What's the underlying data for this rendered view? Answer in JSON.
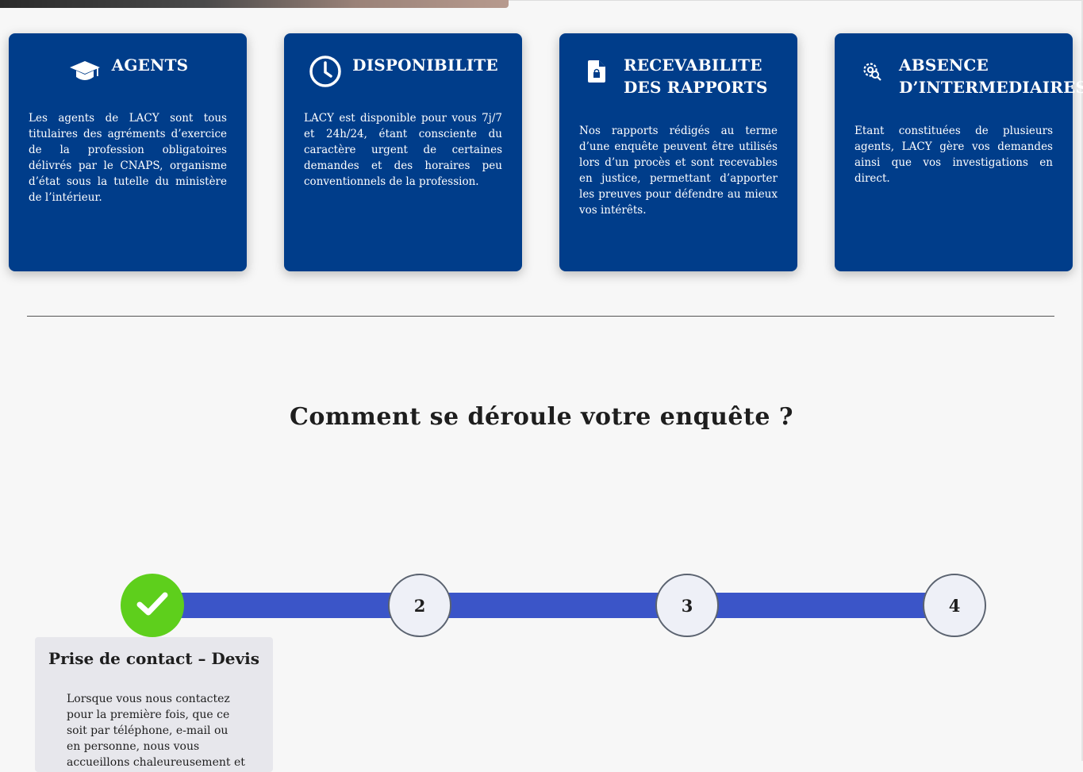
{
  "cards": [
    {
      "icon": "graduation-cap-icon",
      "title": "AGENTS",
      "text": "Les agents de LACY sont tous titulaires des agréments d’exercice de la profession obligatoires délivrés par le CNAPS, organisme d’état sous la tutelle du ministère de l’intérieur."
    },
    {
      "icon": "clock-icon",
      "title": "DISPONIBILITE",
      "text": "LACY est disponible pour vous 7j/7 et 24h/24, étant consciente du caractère urgent de certaines demandes et des horaires peu conventionnels de la profession."
    },
    {
      "icon": "file-lock-icon",
      "title": "RECEVABILITE DES RAPPORTS",
      "text": "Nos rapports rédigés au terme d’une enquête peuvent être utilisés lors d’un procès et sont recevables en justice, permettant d’apporter les preuves pour défendre au mieux vos intérêts."
    },
    {
      "icon": "gear-search-icon",
      "title": "ABSENCE D’INTERMEDIAIRES",
      "text": "Etant constituées de plusieurs agents, LACY gère vos demandes ainsi que vos investigations en direct."
    }
  ],
  "process": {
    "title": "Comment se déroule votre enquête ?",
    "steps": [
      {
        "label": "",
        "status": "done",
        "icon": "check-icon"
      },
      {
        "label": "2",
        "status": "pending"
      },
      {
        "label": "3",
        "status": "pending"
      },
      {
        "label": "4",
        "status": "pending"
      }
    ],
    "active_step": {
      "title": "Prise de contact – Devis",
      "text": "Lorsque vous nous contactez pour la première fois, que ce soit par téléphone, e-mail ou en personne, nous vous accueillons chaleureusement et"
    }
  },
  "colors": {
    "card_bg": "#003d8a",
    "track": "#3b55c8",
    "step_done": "#5ecf1c"
  }
}
